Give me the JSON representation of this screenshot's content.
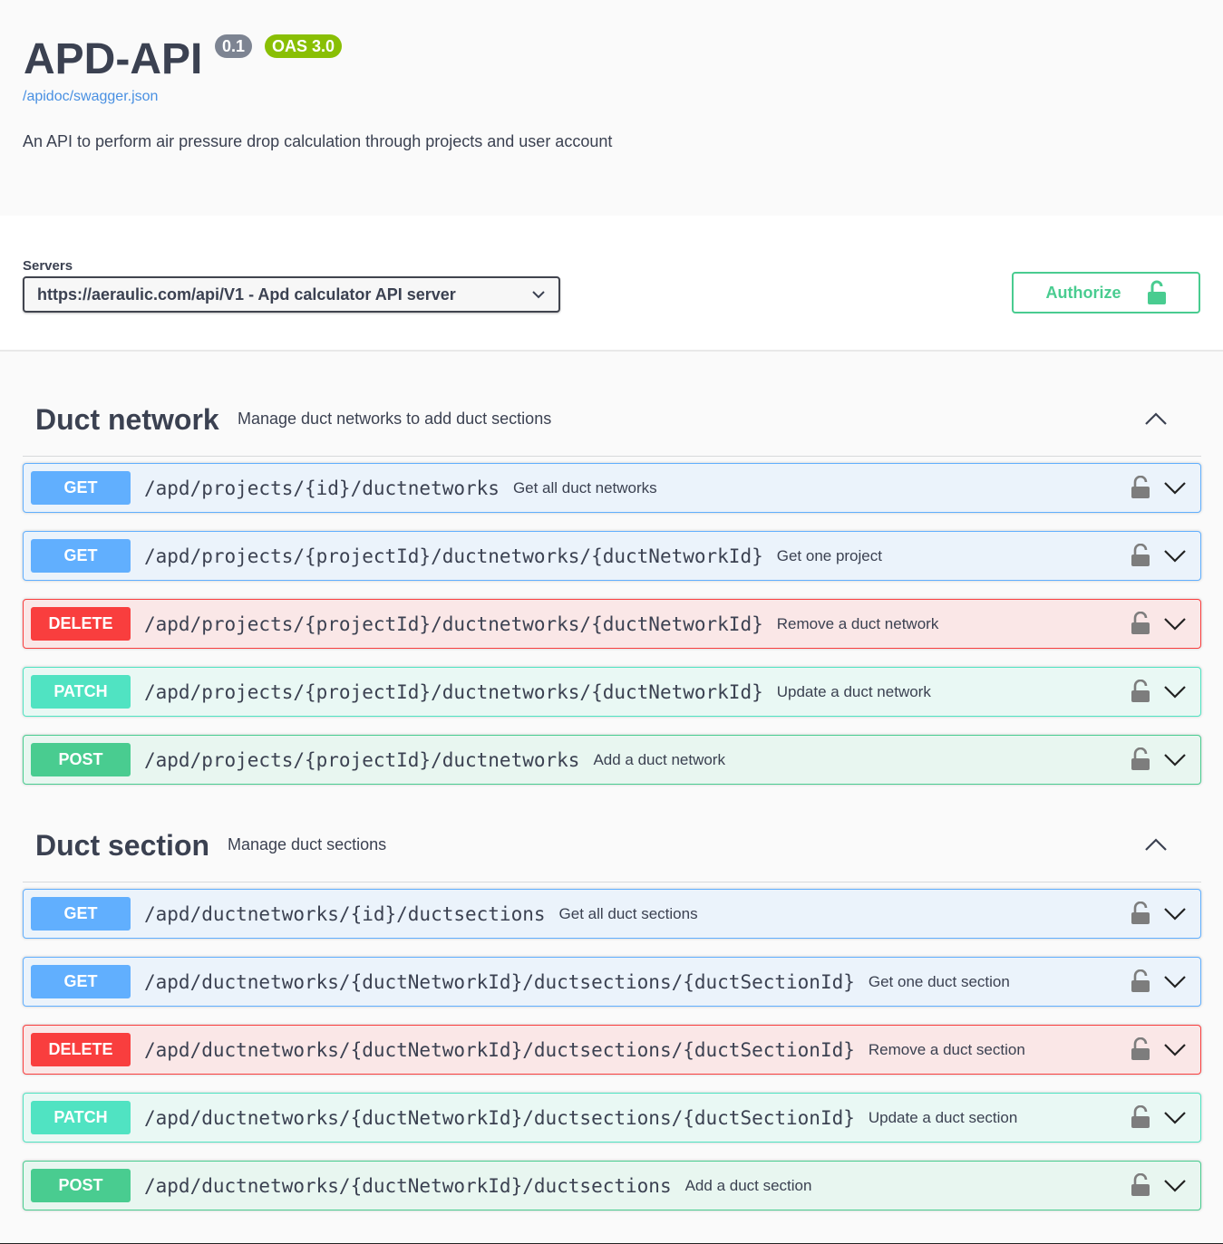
{
  "info": {
    "title": "APD-API",
    "version": "0.1",
    "oas": "OAS 3.0",
    "spec_link": "/apidoc/swagger.json",
    "description": "An API to perform air pressure drop calculation through projects and user account"
  },
  "servers": {
    "label": "Servers",
    "selected": "https://aeraulic.com/api/V1 - Apd calculator API server"
  },
  "authorize": {
    "label": "Authorize",
    "icon": "unlocked-icon"
  },
  "colors": {
    "get": "#61affe",
    "delete": "#f93e3e",
    "patch": "#50e3c2",
    "post": "#49cc90"
  },
  "tags": [
    {
      "name": "Duct network",
      "description": "Manage duct networks to add duct sections",
      "operations": [
        {
          "method": "GET",
          "path": "/apd/projects/{id}/ductnetworks",
          "summary": "Get all duct networks"
        },
        {
          "method": "GET",
          "path": "/apd/projects/{projectId}/ductnetworks/{ductNetworkId}",
          "summary": "Get one project"
        },
        {
          "method": "DELETE",
          "path": "/apd/projects/{projectId}/ductnetworks/{ductNetworkId}",
          "summary": "Remove a duct network"
        },
        {
          "method": "PATCH",
          "path": "/apd/projects/{projectId}/ductnetworks/{ductNetworkId}",
          "summary": "Update a duct network"
        },
        {
          "method": "POST",
          "path": "/apd/projects/{projectId}/ductnetworks",
          "summary": "Add a duct network"
        }
      ]
    },
    {
      "name": "Duct section",
      "description": "Manage duct sections",
      "operations": [
        {
          "method": "GET",
          "path": "/apd/ductnetworks/{id}/ductsections",
          "summary": "Get all duct sections"
        },
        {
          "method": "GET",
          "path": "/apd/ductnetworks/{ductNetworkId}/ductsections/{ductSectionId}",
          "summary": "Get one duct section"
        },
        {
          "method": "DELETE",
          "path": "/apd/ductnetworks/{ductNetworkId}/ductsections/{ductSectionId}",
          "summary": "Remove a duct section"
        },
        {
          "method": "PATCH",
          "path": "/apd/ductnetworks/{ductNetworkId}/ductsections/{ductSectionId}",
          "summary": "Update a duct section"
        },
        {
          "method": "POST",
          "path": "/apd/ductnetworks/{ductNetworkId}/ductsections",
          "summary": "Add a duct section"
        }
      ]
    }
  ]
}
